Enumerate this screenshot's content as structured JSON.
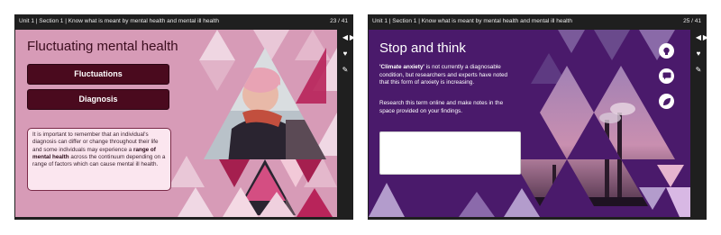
{
  "left_panel": {
    "breadcrumb": "Unit 1  |  Section 1  |  Know what is meant by mental health and mental ill health",
    "page_indicator": "23 / 41",
    "title": "Fluctuating mental health",
    "buttons": [
      "Fluctuations",
      "Diagnosis"
    ],
    "info_text_1": "It is important to remember that an individual's diagnosis can differ or change throughout their life and some individuals may experience a ",
    "info_bold": "range of mental health",
    "info_text_2": " across the continuum depending on a range of factors which can cause mental ill health."
  },
  "right_panel": {
    "breadcrumb": "Unit 1  |  Section 1  |  Know what is meant by mental health and mental ill health",
    "page_indicator": "25 / 41",
    "title": "Stop and think",
    "para1_bold": "'Climate anxiety'",
    "para1_text": " is not currently a diagnosable condition, but researchers and experts have noted that this form of anxiety is increasing.",
    "para2": "Research this term online and make notes in the space provided on your findings.",
    "notes_value": "",
    "side_icons": [
      "lightbulb-icon",
      "chat-icon",
      "leaf-icon"
    ]
  },
  "rail_icons": [
    "prev-arrow-icon",
    "next-arrow-icon",
    "heart-icon",
    "pencil-icon"
  ],
  "colors": {
    "pink_bg": "#d79bb7",
    "maroon": "#4a0a1e",
    "purple_bg": "#4a1a6b",
    "frame": "#1f1f1f"
  }
}
